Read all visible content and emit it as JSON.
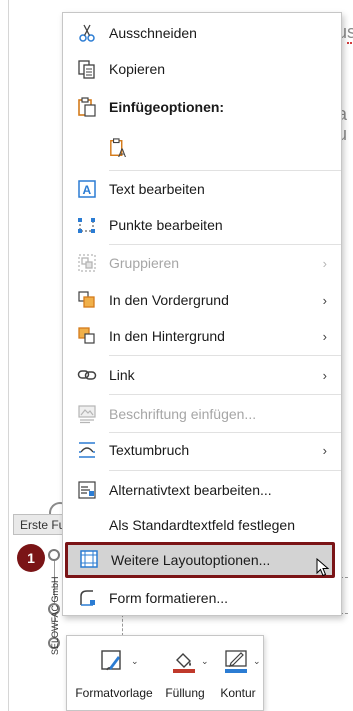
{
  "menu": {
    "items": [
      {
        "id": "ausschneiden",
        "label": "Ausschneiden",
        "icon": "scissors-icon",
        "enabled": true
      },
      {
        "id": "kopieren",
        "label": "Kopieren",
        "icon": "copy-icon",
        "enabled": true
      },
      {
        "id": "einfuegeoptionen",
        "label": "Einfügeoptionen:",
        "icon": "paste-icon",
        "enabled": true
      },
      {
        "id": "paste-keep-text",
        "label": "",
        "icon": "paste-text-only-icon",
        "enabled": true
      },
      {
        "id": "text-bearbeiten",
        "label": "Text bearbeiten",
        "icon": "edit-text-icon",
        "enabled": true
      },
      {
        "id": "punkte-bearbeiten",
        "label": "Punkte bearbeiten",
        "icon": "edit-points-icon",
        "enabled": true
      },
      {
        "id": "gruppieren",
        "label": "Gruppieren",
        "icon": "group-icon",
        "enabled": false,
        "submenu": true
      },
      {
        "id": "vordergrund",
        "label": "In den Vordergrund",
        "icon": "bring-forward-icon",
        "enabled": true,
        "submenu": true
      },
      {
        "id": "hintergrund",
        "label": "In den Hintergrund",
        "icon": "send-backward-icon",
        "enabled": true,
        "submenu": true
      },
      {
        "id": "link",
        "label": "Link",
        "icon": "link-icon",
        "enabled": true,
        "submenu": true
      },
      {
        "id": "beschriftung",
        "label": "Beschriftung einfügen...",
        "icon": "insert-caption-icon",
        "enabled": false
      },
      {
        "id": "textumbruch",
        "label": "Textumbruch",
        "icon": "wrap-text-icon",
        "enabled": true,
        "submenu": true
      },
      {
        "id": "alternativtext",
        "label": "Alternativtext bearbeiten...",
        "icon": "alt-text-icon",
        "enabled": true
      },
      {
        "id": "standardtextfeld",
        "label": "Als Standardtextfeld festlegen",
        "icon": "",
        "enabled": true
      },
      {
        "id": "layoutoptionen",
        "label": "Weitere Layoutoptionen...",
        "icon": "layout-options-icon",
        "enabled": true,
        "highlighted": true
      },
      {
        "id": "form-formatieren",
        "label": "Form formatieren...",
        "icon": "format-shape-icon",
        "enabled": true
      }
    ],
    "submenu_arrow": "›"
  },
  "toolbar": {
    "buttons": [
      {
        "id": "formatvorlage",
        "label": "Formatvorlage",
        "icon": "style-brush-icon"
      },
      {
        "id": "fuellung",
        "label": "Füllung",
        "icon": "fill-bucket-icon"
      },
      {
        "id": "kontur",
        "label": "Kontur",
        "icon": "outline-pen-icon"
      }
    ],
    "chevron": "⌄"
  },
  "document": {
    "label_box": "Erste Fu",
    "vertical_text": "SELOWFAC GmbH",
    "badge": "1"
  },
  "colors": {
    "accent_blue": "#2b7cd3",
    "highlight_border": "#7a1416",
    "highlight_bg": "#d3d3d3",
    "disabled_text": "#a6a6a6",
    "badge_bg": "#7a1416",
    "paste_orange": "#d47b1b",
    "fill_red": "#c0392b",
    "outline_blue": "#2b7cd3"
  }
}
